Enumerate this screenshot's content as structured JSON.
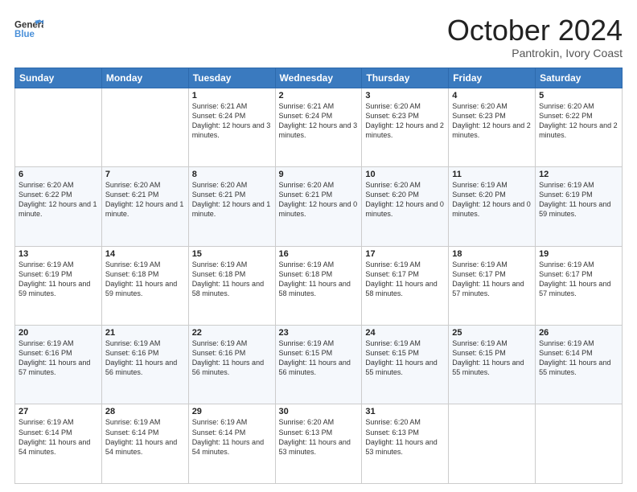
{
  "header": {
    "logo_line1": "General",
    "logo_line2": "Blue",
    "month": "October 2024",
    "location": "Pantrokin, Ivory Coast"
  },
  "days_of_week": [
    "Sunday",
    "Monday",
    "Tuesday",
    "Wednesday",
    "Thursday",
    "Friday",
    "Saturday"
  ],
  "weeks": [
    [
      {
        "day": "",
        "info": ""
      },
      {
        "day": "",
        "info": ""
      },
      {
        "day": "1",
        "info": "Sunrise: 6:21 AM\nSunset: 6:24 PM\nDaylight: 12 hours and 3 minutes."
      },
      {
        "day": "2",
        "info": "Sunrise: 6:21 AM\nSunset: 6:24 PM\nDaylight: 12 hours and 3 minutes."
      },
      {
        "day": "3",
        "info": "Sunrise: 6:20 AM\nSunset: 6:23 PM\nDaylight: 12 hours and 2 minutes."
      },
      {
        "day": "4",
        "info": "Sunrise: 6:20 AM\nSunset: 6:23 PM\nDaylight: 12 hours and 2 minutes."
      },
      {
        "day": "5",
        "info": "Sunrise: 6:20 AM\nSunset: 6:22 PM\nDaylight: 12 hours and 2 minutes."
      }
    ],
    [
      {
        "day": "6",
        "info": "Sunrise: 6:20 AM\nSunset: 6:22 PM\nDaylight: 12 hours and 1 minute."
      },
      {
        "day": "7",
        "info": "Sunrise: 6:20 AM\nSunset: 6:21 PM\nDaylight: 12 hours and 1 minute."
      },
      {
        "day": "8",
        "info": "Sunrise: 6:20 AM\nSunset: 6:21 PM\nDaylight: 12 hours and 1 minute."
      },
      {
        "day": "9",
        "info": "Sunrise: 6:20 AM\nSunset: 6:21 PM\nDaylight: 12 hours and 0 minutes."
      },
      {
        "day": "10",
        "info": "Sunrise: 6:20 AM\nSunset: 6:20 PM\nDaylight: 12 hours and 0 minutes."
      },
      {
        "day": "11",
        "info": "Sunrise: 6:19 AM\nSunset: 6:20 PM\nDaylight: 12 hours and 0 minutes."
      },
      {
        "day": "12",
        "info": "Sunrise: 6:19 AM\nSunset: 6:19 PM\nDaylight: 11 hours and 59 minutes."
      }
    ],
    [
      {
        "day": "13",
        "info": "Sunrise: 6:19 AM\nSunset: 6:19 PM\nDaylight: 11 hours and 59 minutes."
      },
      {
        "day": "14",
        "info": "Sunrise: 6:19 AM\nSunset: 6:18 PM\nDaylight: 11 hours and 59 minutes."
      },
      {
        "day": "15",
        "info": "Sunrise: 6:19 AM\nSunset: 6:18 PM\nDaylight: 11 hours and 58 minutes."
      },
      {
        "day": "16",
        "info": "Sunrise: 6:19 AM\nSunset: 6:18 PM\nDaylight: 11 hours and 58 minutes."
      },
      {
        "day": "17",
        "info": "Sunrise: 6:19 AM\nSunset: 6:17 PM\nDaylight: 11 hours and 58 minutes."
      },
      {
        "day": "18",
        "info": "Sunrise: 6:19 AM\nSunset: 6:17 PM\nDaylight: 11 hours and 57 minutes."
      },
      {
        "day": "19",
        "info": "Sunrise: 6:19 AM\nSunset: 6:17 PM\nDaylight: 11 hours and 57 minutes."
      }
    ],
    [
      {
        "day": "20",
        "info": "Sunrise: 6:19 AM\nSunset: 6:16 PM\nDaylight: 11 hours and 57 minutes."
      },
      {
        "day": "21",
        "info": "Sunrise: 6:19 AM\nSunset: 6:16 PM\nDaylight: 11 hours and 56 minutes."
      },
      {
        "day": "22",
        "info": "Sunrise: 6:19 AM\nSunset: 6:16 PM\nDaylight: 11 hours and 56 minutes."
      },
      {
        "day": "23",
        "info": "Sunrise: 6:19 AM\nSunset: 6:15 PM\nDaylight: 11 hours and 56 minutes."
      },
      {
        "day": "24",
        "info": "Sunrise: 6:19 AM\nSunset: 6:15 PM\nDaylight: 11 hours and 55 minutes."
      },
      {
        "day": "25",
        "info": "Sunrise: 6:19 AM\nSunset: 6:15 PM\nDaylight: 11 hours and 55 minutes."
      },
      {
        "day": "26",
        "info": "Sunrise: 6:19 AM\nSunset: 6:14 PM\nDaylight: 11 hours and 55 minutes."
      }
    ],
    [
      {
        "day": "27",
        "info": "Sunrise: 6:19 AM\nSunset: 6:14 PM\nDaylight: 11 hours and 54 minutes."
      },
      {
        "day": "28",
        "info": "Sunrise: 6:19 AM\nSunset: 6:14 PM\nDaylight: 11 hours and 54 minutes."
      },
      {
        "day": "29",
        "info": "Sunrise: 6:19 AM\nSunset: 6:14 PM\nDaylight: 11 hours and 54 minutes."
      },
      {
        "day": "30",
        "info": "Sunrise: 6:20 AM\nSunset: 6:13 PM\nDaylight: 11 hours and 53 minutes."
      },
      {
        "day": "31",
        "info": "Sunrise: 6:20 AM\nSunset: 6:13 PM\nDaylight: 11 hours and 53 minutes."
      },
      {
        "day": "",
        "info": ""
      },
      {
        "day": "",
        "info": ""
      }
    ]
  ]
}
